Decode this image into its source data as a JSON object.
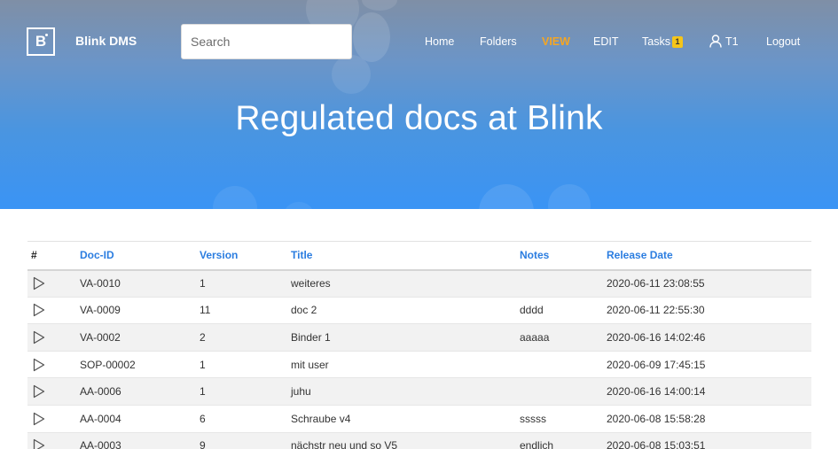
{
  "app": {
    "brand": "Blink DMS",
    "logo_letter": "B"
  },
  "search": {
    "placeholder": "Search",
    "value": ""
  },
  "nav": {
    "home": "Home",
    "folders": "Folders",
    "view": "VIEW",
    "edit": "EDIT",
    "tasks": "Tasks",
    "tasks_count": "1",
    "user": "T1",
    "logout": "Logout"
  },
  "colors": {
    "accent": "#f5a623",
    "link": "#2b7de0",
    "badge": "#f5c518"
  },
  "hero": {
    "title": "Regulated docs at Blink"
  },
  "table": {
    "headers": [
      "#",
      "Doc-ID",
      "Version",
      "Title",
      "Notes",
      "Release Date"
    ],
    "rows": [
      {
        "doc_id": "VA-0010",
        "version": "1",
        "title": "weiteres",
        "notes": "",
        "release": "2020-06-11 23:08:55"
      },
      {
        "doc_id": "VA-0009",
        "version": "11",
        "title": "doc 2",
        "notes": "dddd",
        "release": "2020-06-11 22:55:30"
      },
      {
        "doc_id": "VA-0002",
        "version": "2",
        "title": "Binder 1",
        "notes": "aaaaa",
        "release": "2020-06-16 14:02:46"
      },
      {
        "doc_id": "SOP-00002",
        "version": "1",
        "title": "mit user",
        "notes": "",
        "release": "2020-06-09 17:45:15"
      },
      {
        "doc_id": "AA-0006",
        "version": "1",
        "title": "juhu",
        "notes": "",
        "release": "2020-06-16 14:00:14"
      },
      {
        "doc_id": "AA-0004",
        "version": "6",
        "title": "Schraube v4",
        "notes": "sssss",
        "release": "2020-06-08 15:58:28"
      },
      {
        "doc_id": "AA-0003",
        "version": "9",
        "title": "nächstr neu und so V5",
        "notes": "endlich",
        "release": "2020-06-08 15:03:51"
      }
    ]
  },
  "icons": {
    "row_action": "play-icon",
    "user": "user-icon",
    "logo": "logo-icon"
  }
}
